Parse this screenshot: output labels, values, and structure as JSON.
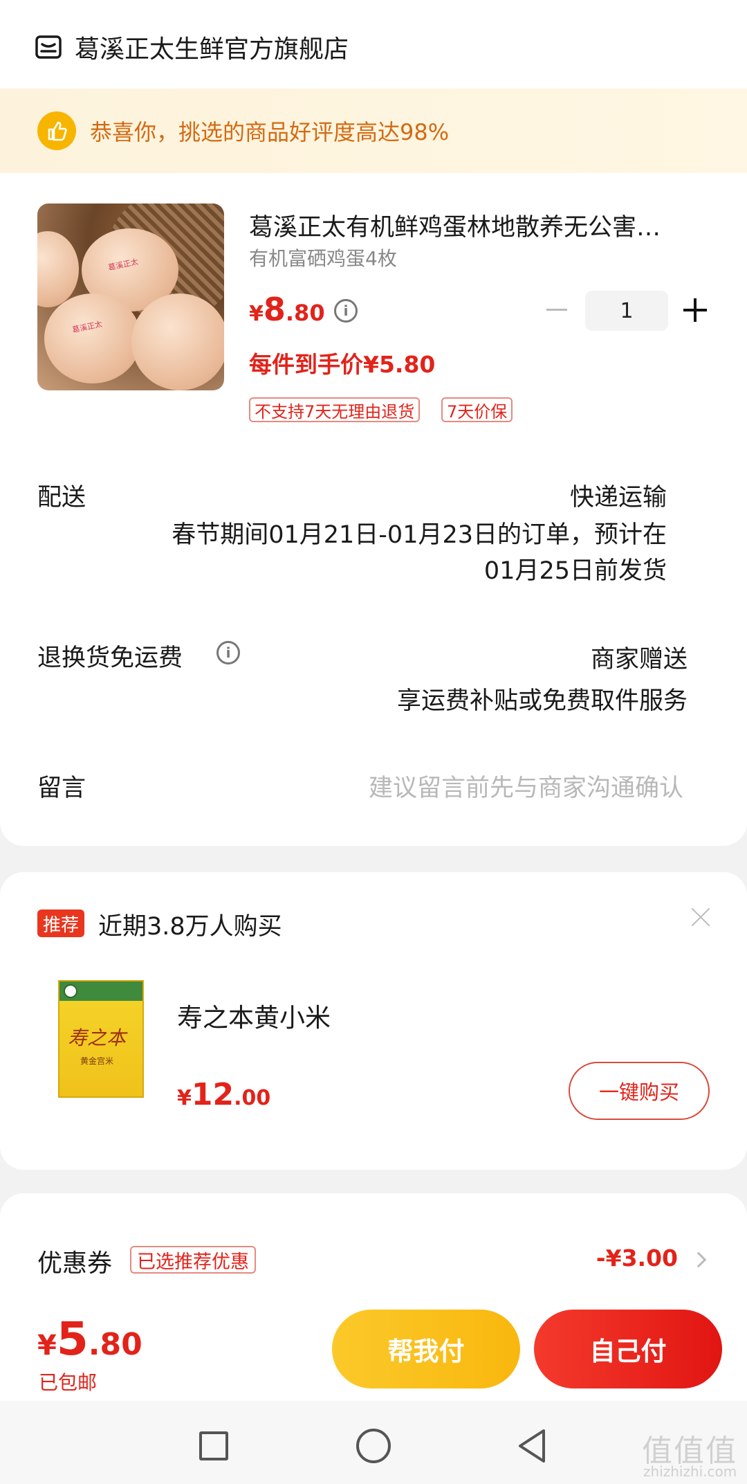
{
  "store": {
    "name": "葛溪正太生鲜官方旗舰店",
    "praise": "恭喜你，挑选的商品好评度高达98%"
  },
  "product": {
    "title": "葛溪正太有机鲜鸡蛋林地散养无公害…",
    "spec": "有机富硒鸡蛋4枚",
    "price_symbol": "¥",
    "price_int": "8",
    "price_dec": ".80",
    "hand_price": "每件到手价¥5.80",
    "quantity": "1",
    "tags": [
      "不支持7天无理由退货",
      "7天价保"
    ],
    "egg_print": "葛溪正太"
  },
  "delivery": {
    "label": "配送",
    "method": "快递运输",
    "note_line1": "春节期间01月21日-01月23日的订单，预计在",
    "note_line2": "01月25日前发货"
  },
  "returns": {
    "label": "退换货免运费",
    "value_line1": "商家赠送",
    "value_line2": "享运费补贴或免费取件服务"
  },
  "message": {
    "label": "留言",
    "placeholder": "建议留言前先与商家沟通确认"
  },
  "recommend": {
    "badge": "推荐",
    "title": "近期3.8万人购买",
    "item_name": "寿之本黄小米",
    "price_symbol": "¥",
    "price_int": "12",
    "price_dec": ".00",
    "buy_label": "一键购买",
    "package_brand": "寿之本",
    "package_sub": "黄金宫米"
  },
  "coupon": {
    "label": "优惠券",
    "tag": "已选推荐优惠",
    "amount": "-¥3.00"
  },
  "footer": {
    "total_symbol": "¥",
    "total_int": "5",
    "total_dec": ".80",
    "shipping": "已包邮",
    "help_pay": "帮我付",
    "self_pay": "自己付"
  },
  "watermark": {
    "logo": "值值值",
    "site": "zhizhizhi.com"
  },
  "colors": {
    "accent_red": "#e2231a",
    "help_pay_yellow": "#fbc92a",
    "praise_orange": "#d36a12"
  }
}
